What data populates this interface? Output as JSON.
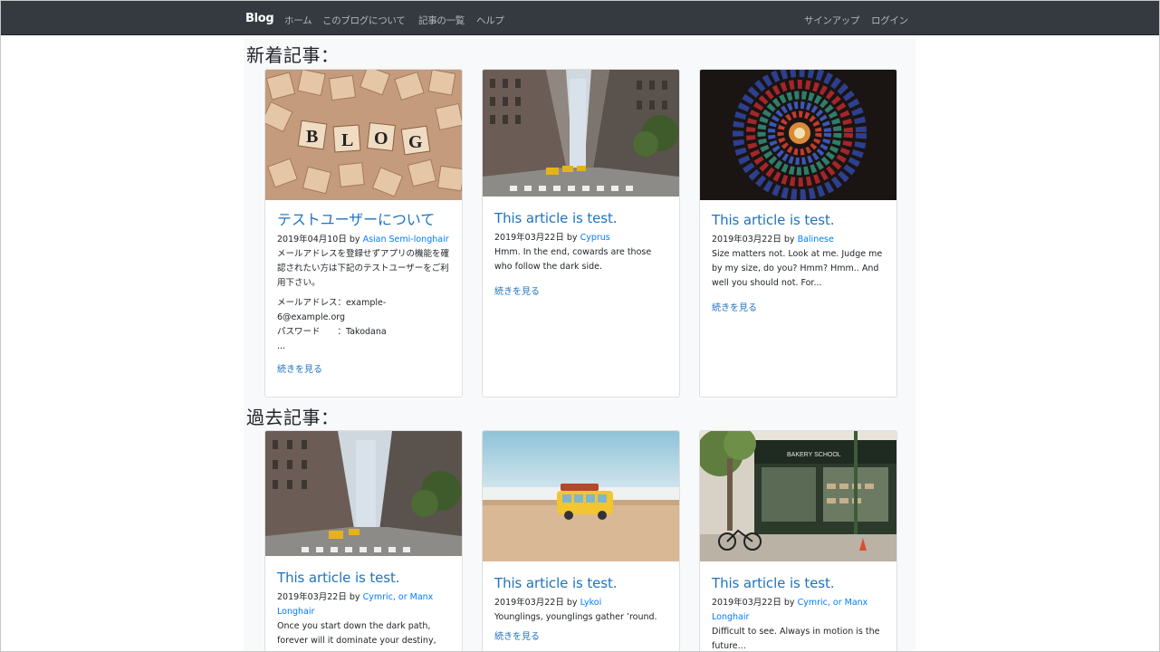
{
  "navbar": {
    "brand": "Blog",
    "links": [
      "ホーム",
      "このブログについて",
      "記事の一覧",
      "ヘルプ"
    ],
    "right_links": [
      "サインアップ",
      "ログイン"
    ]
  },
  "sections": {
    "new_heading": "新着記事：",
    "old_heading": "過去記事："
  },
  "new_posts": [
    {
      "title": "テストユーザーについて",
      "date": "2019年04月10日",
      "by": "by",
      "author": "Asian Semi-longhair",
      "excerpt": "メールアドレスを登録せずアプリの機能を確認されたい方は下記のテストユーザーをご利用下さい。",
      "lines": [
        "メールアドレス：example-6@example.org",
        "パスワード　　：Takodana",
        "..."
      ],
      "more": "続きを見る"
    },
    {
      "title": "This article is test.",
      "date": "2019年03月22日",
      "by": "by",
      "author": "Cyprus",
      "excerpt": "Hmm. In the end, cowards are those who follow the dark side.",
      "more": "続きを見る"
    },
    {
      "title": "This article is test.",
      "date": "2019年03月22日",
      "by": "by",
      "author": "Balinese",
      "excerpt": "Size matters not. Look at me. Judge me by my size, do you? Hmm? Hmm.. And well you should not. For...",
      "more": "続きを見る"
    }
  ],
  "old_posts": [
    {
      "title": "This article is test.",
      "date": "2019年03月22日",
      "by": "by",
      "author": "Cymric, or Manx Longhair",
      "excerpt": "Once you start down the dark path, forever will it dominate your destiny,"
    },
    {
      "title": "This article is test.",
      "date": "2019年03月22日",
      "by": "by",
      "author": "Lykoi",
      "excerpt": "Younglings, younglings gather ’round.",
      "more": "続きを見る"
    },
    {
      "title": "This article is test.",
      "date": "2019年03月22日",
      "by": "by",
      "author": "Cymric, or Manx Longhair",
      "excerpt": "Difficult to see. Always in motion is the future..."
    }
  ],
  "images": {
    "blog_sign": "BLOG",
    "bakery_sign": "BAKERY SCHOOL"
  },
  "colors": {
    "navbar_bg": "#343a40",
    "link": "#007bff",
    "title": "#1e73be",
    "container_bg": "#f8f9fa"
  }
}
